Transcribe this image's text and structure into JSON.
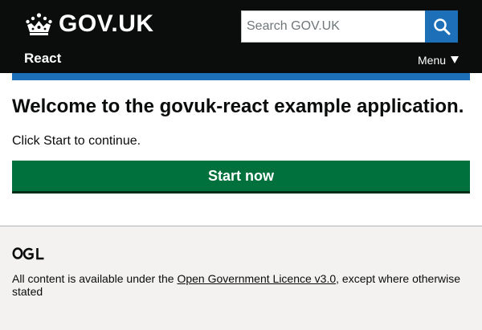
{
  "header": {
    "logo_text": "GOV.UK",
    "service_name": "React",
    "search_placeholder": "Search GOV.UK",
    "search_button_icon": "search-icon",
    "menu_label": "Menu",
    "colors": {
      "background": "#0b0c0c",
      "search_button": "#1d70b8"
    }
  },
  "main": {
    "title": "Welcome to the govuk-react example application.",
    "lead": "Click Start to continue.",
    "start_button_label": "Start now",
    "colors": {
      "accent_bar": "#1d70b8",
      "start_button": "#00703c"
    }
  },
  "footer": {
    "logo_icon": "ogl-logo",
    "licence_prefix": "All content is available under the ",
    "licence_link": "Open Government Licence v3.0",
    "licence_suffix": ", except where otherwise stated"
  }
}
